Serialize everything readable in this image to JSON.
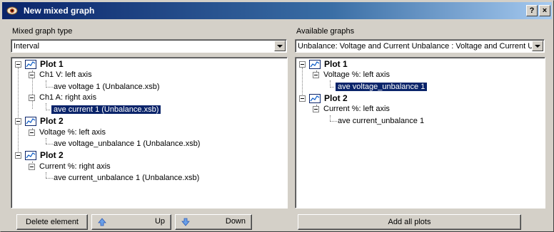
{
  "window": {
    "title": "New mixed graph",
    "help_label": "?",
    "close_label": "×"
  },
  "left": {
    "type_label": "Mixed graph type",
    "type_value": "Interval",
    "tree": {
      "plot1": "Plot 1",
      "ch1v": "Ch1 V: left axis",
      "ave_voltage": "ave voltage 1  (Unbalance.xsb)",
      "ch1a": "Ch1 A: right axis",
      "ave_current": "ave current 1  (Unbalance.xsb)",
      "plot2a": "Plot 2",
      "voltage_pct": "Voltage %: left axis",
      "ave_voltage_unb": "ave voltage_unbalance 1  (Unbalance.xsb)",
      "plot2b": "Plot 2",
      "current_pct": "Current %: right axis",
      "ave_current_unb": "ave current_unbalance 1  (Unbalance.xsb)"
    }
  },
  "right": {
    "graphs_label": "Available graphs",
    "graphs_value": "Unbalance: Voltage and Current Unbalance : Voltage and Current Un",
    "tree": {
      "plot1": "Plot 1",
      "voltage_pct": "Voltage %: left axis",
      "ave_voltage_unb": "ave voltage_unbalance 1",
      "plot2": "Plot 2",
      "current_pct": "Current %: left axis",
      "ave_current_unb": "ave current_unbalance 1"
    }
  },
  "buttons": {
    "delete": "Delete element",
    "up": "Up",
    "down": "Down",
    "add_all": "Add all plots"
  },
  "colors": {
    "title_start": "#0a246a",
    "title_end": "#a6caf0",
    "selection": "#0a246a",
    "face": "#d4d0c8"
  }
}
